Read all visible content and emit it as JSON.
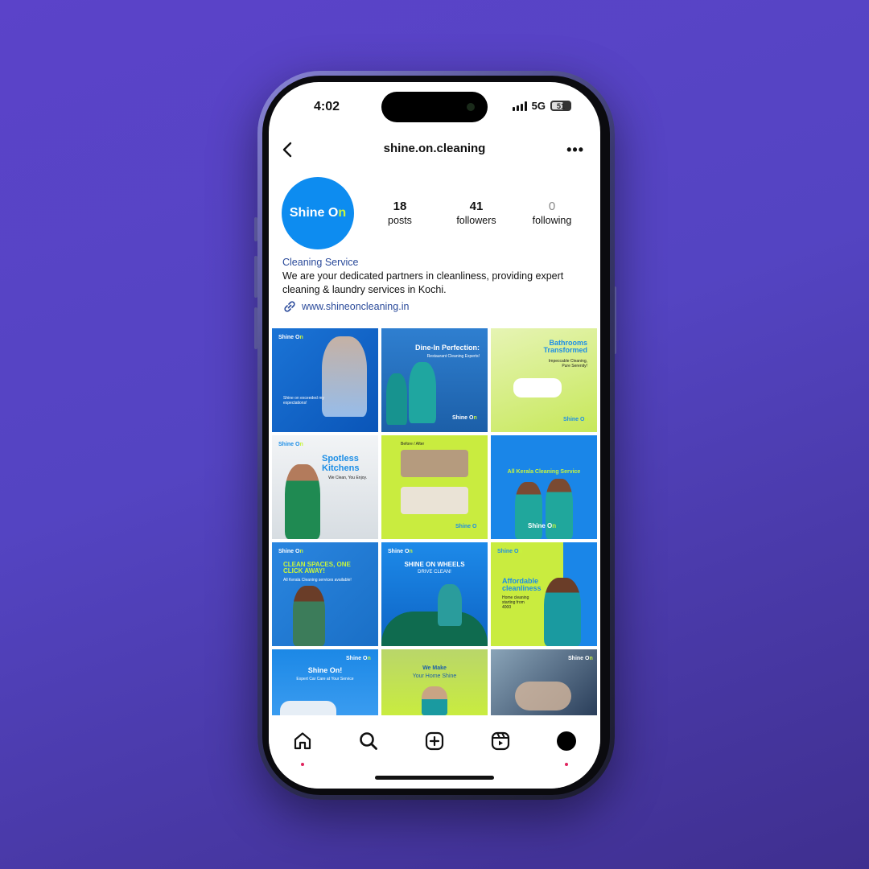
{
  "status_bar": {
    "time": "4:02",
    "network": "5G",
    "battery": "51"
  },
  "header": {
    "username": "shine.on.cleaning",
    "more_label": "•••"
  },
  "profile": {
    "avatar_text_main": "Shine O",
    "avatar_text_accent": "n",
    "stats": [
      {
        "value": "18",
        "label": "posts"
      },
      {
        "value": "41",
        "label": "followers"
      },
      {
        "value": "0",
        "label": "following"
      }
    ],
    "category": "Cleaning Service",
    "bio": "We are your dedicated partners in cleanliness, providing expert cleaning & laundry services in Kochi.",
    "link": "www.shineoncleaning.in"
  },
  "posts": [
    {
      "headline": "",
      "sub": "Shine on exceeded my expectations!"
    },
    {
      "headline": "Dine-In Perfection:",
      "sub": "Restaurant Cleaning Experts!"
    },
    {
      "headline": "Bathrooms Transformed",
      "sub": "Impeccable Cleaning, Pure Serenity!"
    },
    {
      "headline": "Spotless Kitchens",
      "sub": "We Clean, You Enjoy."
    },
    {
      "headline": "",
      "sub": "Before / After"
    },
    {
      "headline": "All Kerala Cleaning Service",
      "sub": ""
    },
    {
      "headline": "CLEAN SPACES, ONE CLICK AWAY!",
      "sub": "All Kerala Cleaning services available!"
    },
    {
      "headline": "SHINE ON WHEELS",
      "sub": "DRIVE CLEAN!"
    },
    {
      "headline": "Affordable cleanliness",
      "sub": "Home cleaning starting from 4000"
    },
    {
      "headline": "Shine On!",
      "sub": "Expert Car Care at Your Service"
    },
    {
      "headline": "We Make",
      "sub": "Your Home Shine"
    },
    {
      "headline": "",
      "sub": ""
    }
  ],
  "brand": {
    "name": "Shine O",
    "accent": "n"
  },
  "colors": {
    "brand_blue": "#0d8cf0",
    "brand_lime": "#c7f53d",
    "background": "#5b43c9"
  }
}
